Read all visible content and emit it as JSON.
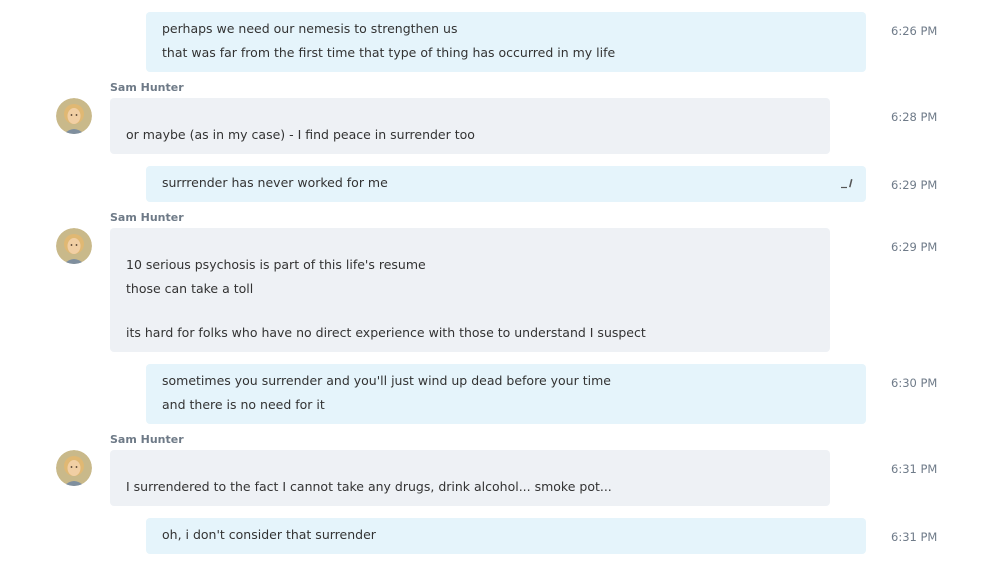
{
  "messages": [
    {
      "lines": [
        "perhaps we need our nemesis to strengthen us",
        "that was far from the first time that type of thing has occurred in my life"
      ],
      "time": "6:26 PM"
    },
    {
      "sender": "Sam Hunter",
      "lines": [
        "or maybe (as in my case) - I find peace in surrender too"
      ],
      "time": "6:28 PM"
    },
    {
      "lines": [
        "surrrender has never worked for me"
      ],
      "time": "6:29 PM",
      "edited_icon": "edited-pencil-icon"
    },
    {
      "sender": "Sam Hunter",
      "lines": [
        "10 serious psychosis is part of this life's resume",
        "those can take a toll",
        "its hard for folks who have no direct experience with those to understand I suspect"
      ],
      "time": "6:29 PM"
    },
    {
      "lines": [
        "sometimes you surrender and you'll just wind up dead before your time",
        "and there is no need for it"
      ],
      "time": "6:30 PM"
    },
    {
      "sender": "Sam Hunter",
      "lines": [
        "I surrendered to the fact I cannot take any drugs, drink alcohol... smoke pot..."
      ],
      "time": "6:31 PM"
    },
    {
      "lines": [
        "oh, i don't consider that surrender"
      ],
      "time": "6:31 PM"
    }
  ],
  "colors": {
    "outgoing_bubble": "#e5f4fb",
    "incoming_bubble": "#eef1f5",
    "timestamp": "#6f7b89",
    "sender_name": "#6e7a87"
  }
}
